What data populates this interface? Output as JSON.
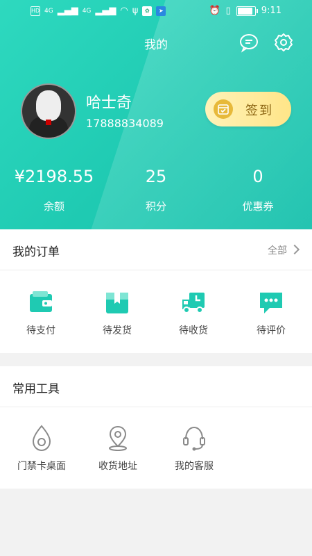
{
  "status_bar": {
    "left_indicators": [
      "HD",
      "4G",
      "4G"
    ],
    "time": "9:11"
  },
  "header": {
    "title": "我的",
    "message_icon": "chat-bubble-icon",
    "settings_icon": "gear-icon"
  },
  "profile": {
    "name": "哈士奇",
    "phone": "17888834089",
    "signin_label": "签到"
  },
  "stats": [
    {
      "value": "¥2198.55",
      "label": "余额"
    },
    {
      "value": "25",
      "label": "积分"
    },
    {
      "value": "0",
      "label": "优惠券"
    }
  ],
  "orders": {
    "title": "我的订单",
    "all_label": "全部",
    "items": [
      {
        "label": "待支付",
        "icon": "wallet-icon"
      },
      {
        "label": "待发货",
        "icon": "package-icon"
      },
      {
        "label": "待收货",
        "icon": "truck-icon"
      },
      {
        "label": "待评价",
        "icon": "comment-icon"
      }
    ]
  },
  "tools": {
    "title": "常用工具",
    "items": [
      {
        "label": "门禁卡桌面",
        "icon": "access-card-icon"
      },
      {
        "label": "收货地址",
        "icon": "location-pin-icon"
      },
      {
        "label": "我的客服",
        "icon": "headset-icon"
      }
    ]
  },
  "colors": {
    "accent": "#1fcab2",
    "signin_bg": "#ffe588",
    "page_bg": "#f2f2f2"
  }
}
